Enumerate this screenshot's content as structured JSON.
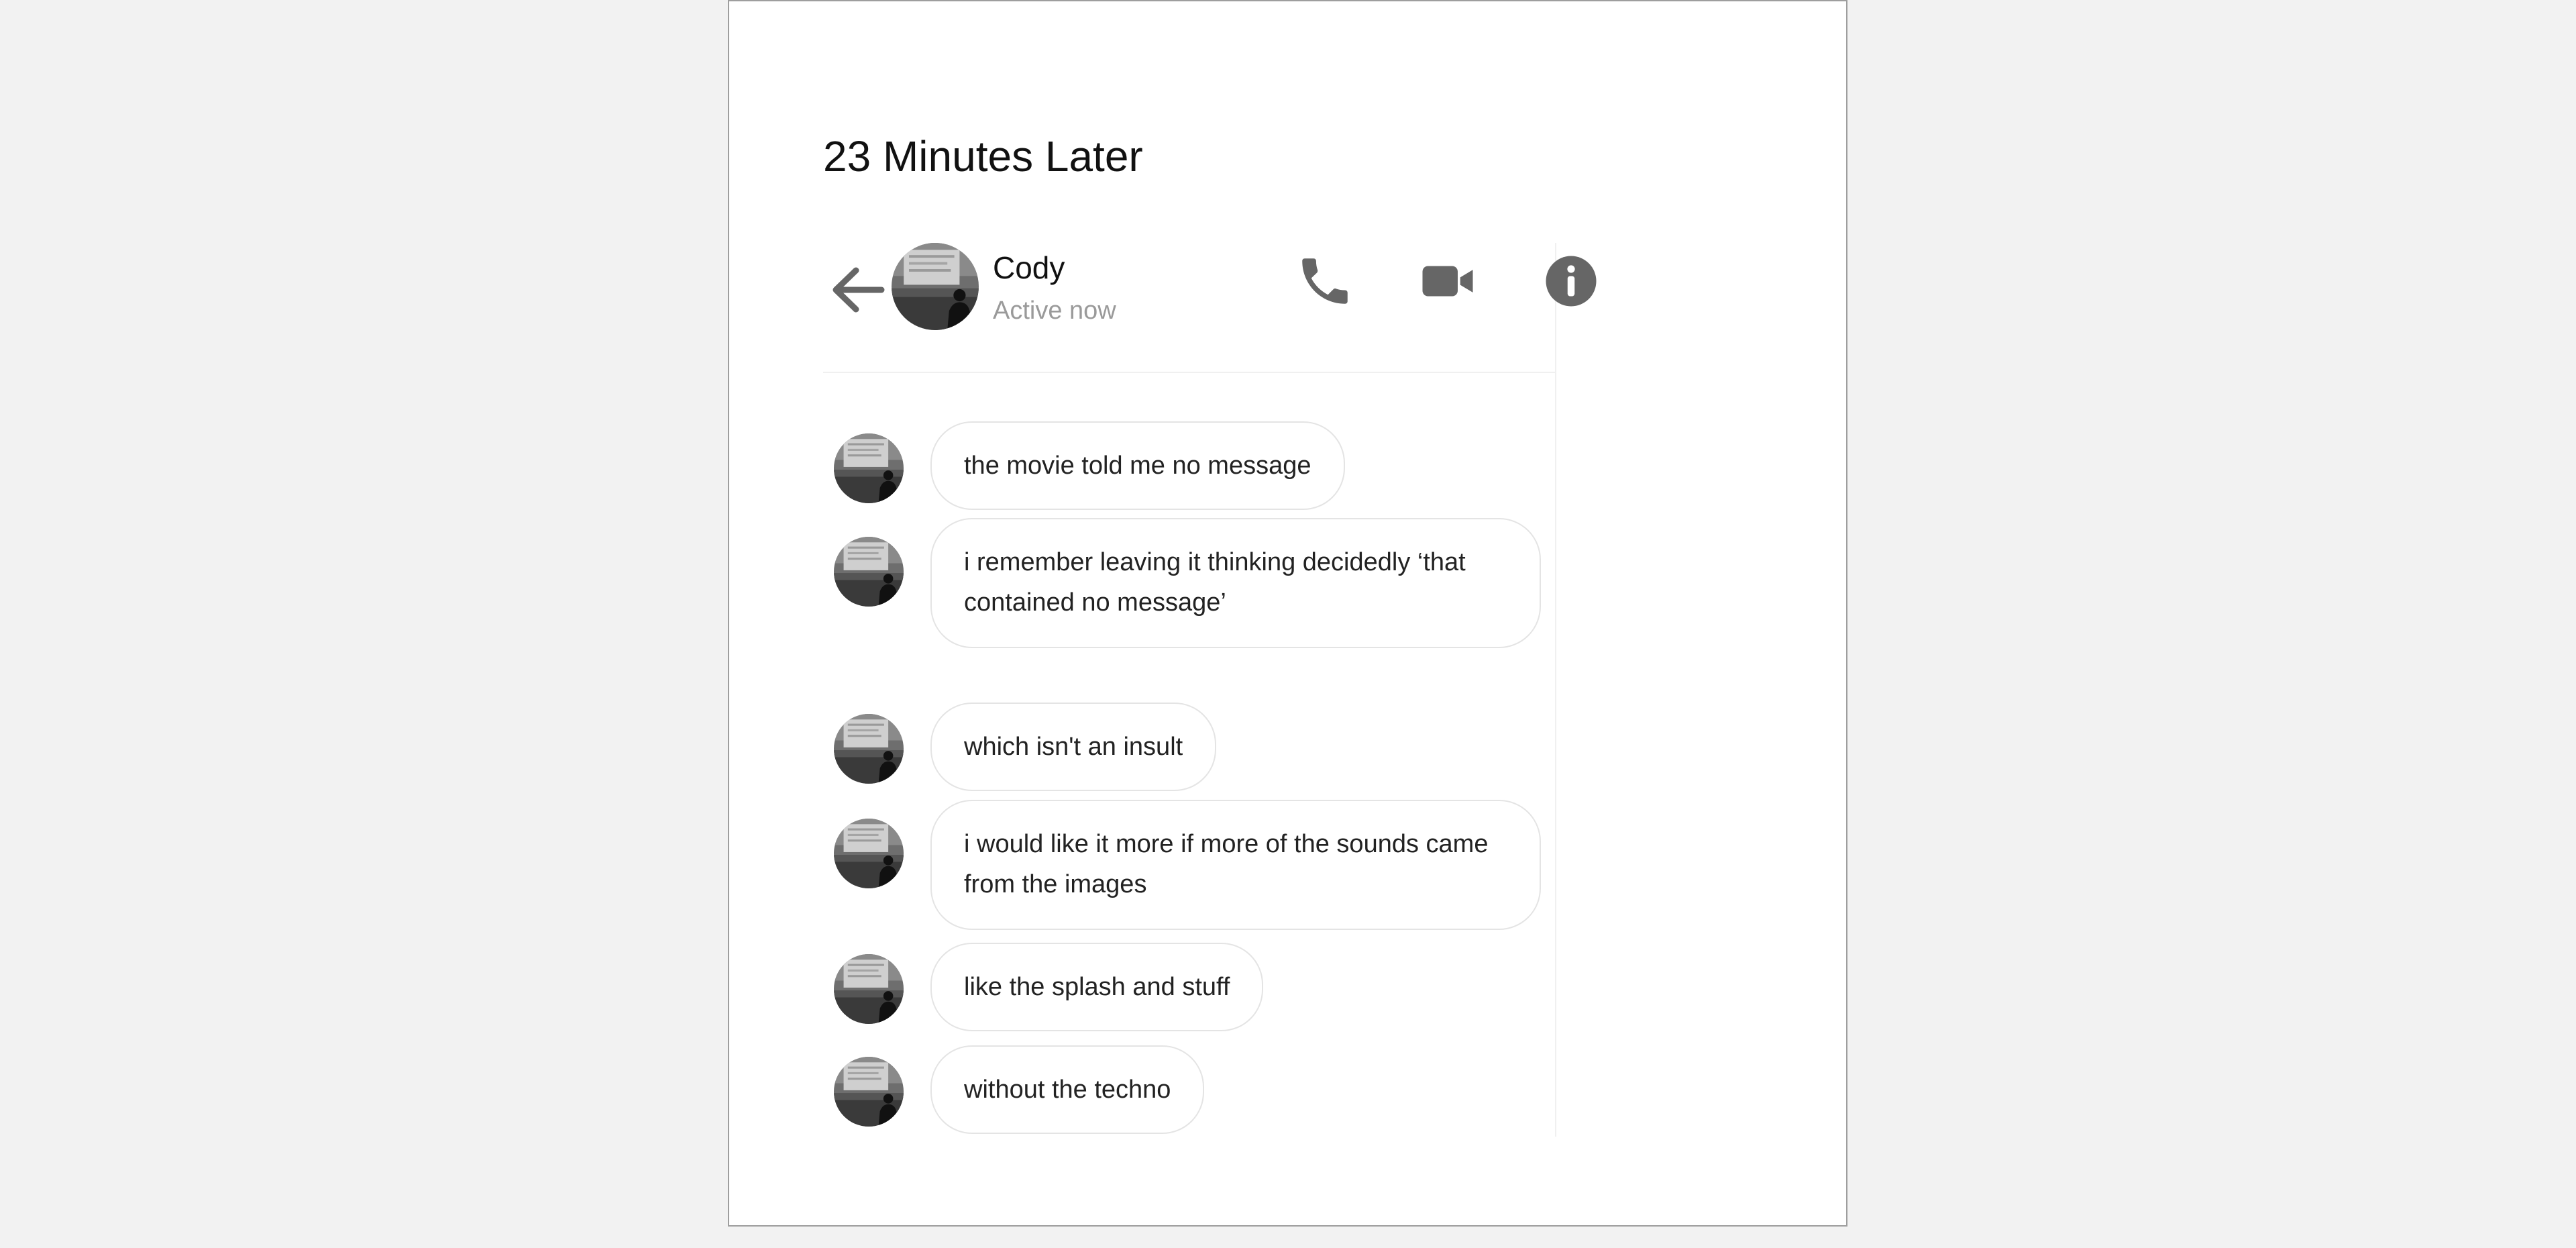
{
  "page": {
    "title": "23 Minutes Later"
  },
  "header": {
    "contact_name": "Cody",
    "status": "Active now",
    "icons": {
      "back": "back-arrow-icon",
      "phone": "phone-icon",
      "video": "video-camera-icon",
      "info": "info-icon"
    },
    "icon_color": "#666666"
  },
  "messages": [
    {
      "text": "the movie told me no message"
    },
    {
      "text": "i remember leaving it thinking decidedly ‘that contained no message’"
    },
    {
      "text": "which isn't an insult"
    },
    {
      "text": "i would like it more if more of the sounds came from the images"
    },
    {
      "text": "like the splash and stuff"
    },
    {
      "text": "without the techno"
    }
  ]
}
